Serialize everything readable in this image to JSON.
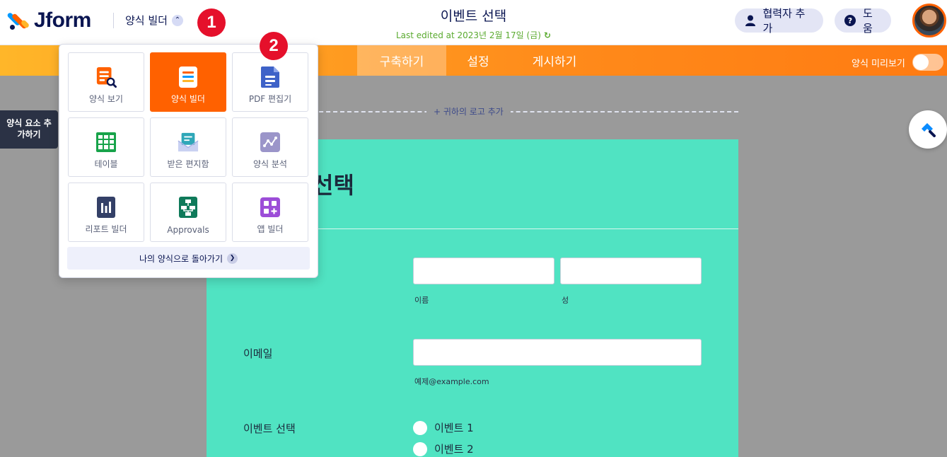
{
  "header": {
    "logo_text": "Jform",
    "builder_label": "양식 빌더",
    "form_title": "이벤트 선택",
    "last_edited": "Last edited at 2023년 2월 17일 (금)",
    "collaborator_button": "협력자 추가",
    "help_button": "도움",
    "badge_1": "1",
    "badge_2": "2"
  },
  "navbar": {
    "tabs": [
      {
        "label": "구축하기",
        "active": true
      },
      {
        "label": "설정",
        "active": false
      },
      {
        "label": "게시하기",
        "active": false
      }
    ],
    "preview_label": "양식 미리보기"
  },
  "sidebar": {
    "add_element_label": "양식 요소 추가하기"
  },
  "canvas": {
    "add_logo_label": "+ 귀하의 로고 추가"
  },
  "form": {
    "heading": "선택",
    "name_first_sub": "이름",
    "name_last_sub": "성",
    "email_label": "이메일",
    "email_sub": "예제@example.com",
    "event_label": "이벤트 선택",
    "options": [
      "이벤트 1",
      "이벤트 2"
    ],
    "background_color": "#50e3c2"
  },
  "popover": {
    "tiles": [
      {
        "label": "양식 보기",
        "icon": "form-view-icon",
        "active": false
      },
      {
        "label": "양식 빌더",
        "icon": "form-builder-icon",
        "active": true
      },
      {
        "label": "PDF 편집기",
        "icon": "pdf-editor-icon",
        "active": false
      },
      {
        "label": "테이블",
        "icon": "table-icon",
        "active": false
      },
      {
        "label": "받은 편지함",
        "icon": "inbox-icon",
        "active": false
      },
      {
        "label": "양식 분석",
        "icon": "analytics-icon",
        "active": false
      },
      {
        "label": "리포트 빌더",
        "icon": "report-builder-icon",
        "active": false
      },
      {
        "label": "Approvals",
        "icon": "approvals-icon",
        "active": false
      },
      {
        "label": "앱 빌더",
        "icon": "app-builder-icon",
        "active": false
      }
    ],
    "back_label": "나의 양식으로 돌아가기"
  },
  "colors": {
    "accent_orange": "#ff6100",
    "navy": "#0a1551",
    "edited_green": "#5aaa2f"
  }
}
